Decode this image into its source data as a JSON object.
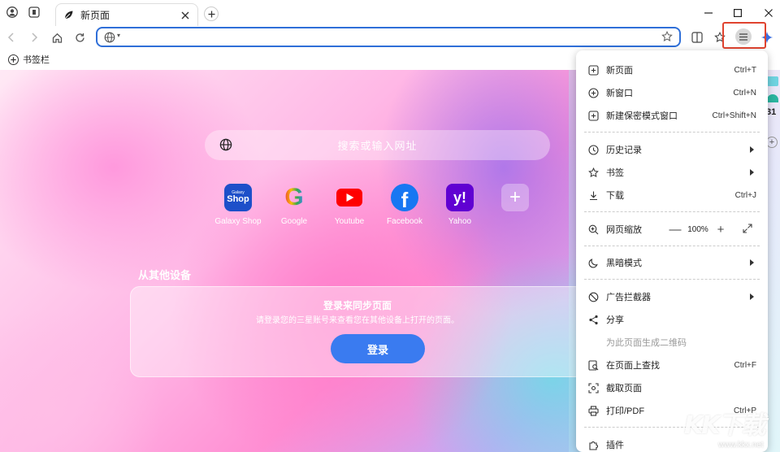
{
  "tab": {
    "title": "新页面"
  },
  "omnibox": {
    "value": "",
    "placeholder": ""
  },
  "bookmarks_bar": {
    "label": "书签栏"
  },
  "newtab": {
    "search_placeholder": "搜索或输入网址",
    "shortcuts": [
      {
        "label": "Galaxy Shop",
        "icon": "galaxy-shop-icon",
        "badge_line1": "Galaxy",
        "badge_line2": "Shop"
      },
      {
        "label": "Google",
        "icon": "google-icon",
        "glyph": "G"
      },
      {
        "label": "Youtube",
        "icon": "youtube-icon"
      },
      {
        "label": "Facebook",
        "icon": "facebook-icon",
        "glyph": "f"
      },
      {
        "label": "Yahoo",
        "icon": "yahoo-icon",
        "glyph": "y!"
      }
    ],
    "add_shortcut": "+",
    "other_devices_title": "从其他设备",
    "sync_title": "登录来同步页面",
    "sync_subtitle": "请登录您的三星账号来查看您在其他设备上打开的页面。",
    "login_button": "登录"
  },
  "menu": {
    "new_tab": {
      "label": "新页面",
      "shortcut": "Ctrl+T"
    },
    "new_window": {
      "label": "新窗口",
      "shortcut": "Ctrl+N"
    },
    "new_private": {
      "label": "新建保密模式窗口",
      "shortcut": "Ctrl+Shift+N"
    },
    "history": {
      "label": "历史记录"
    },
    "bookmarks": {
      "label": "书签"
    },
    "downloads": {
      "label": "下载",
      "shortcut": "Ctrl+J"
    },
    "zoom": {
      "label": "网页缩放",
      "value": "100%",
      "minus": "—",
      "plus": "+"
    },
    "dark_mode": {
      "label": "黑暗模式"
    },
    "ad_blocker": {
      "label": "广告拦截器"
    },
    "share": {
      "label": "分享"
    },
    "qr_code": {
      "label": "为此页面生成二维码"
    },
    "find": {
      "label": "在页面上查找",
      "shortcut": "Ctrl+F"
    },
    "screenshot": {
      "label": "截取页面"
    },
    "print": {
      "label": "打印/PDF",
      "shortcut": "Ctrl+P"
    },
    "extensions": {
      "label": "插件"
    }
  },
  "side_strip": {
    "calendar_day": "31"
  },
  "watermark": {
    "logo": "KK下载",
    "url": "www.kkx.net"
  },
  "colors": {
    "accent": "#2f6fd8",
    "highlight_box": "#e0432f",
    "login_button": "#3a7bf0"
  }
}
